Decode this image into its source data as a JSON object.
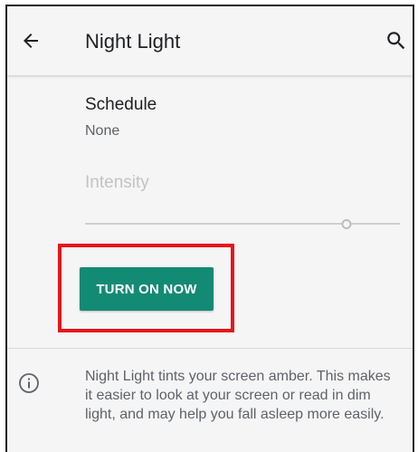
{
  "header": {
    "back_icon": "arrow-back-icon",
    "title": "Night Light",
    "search_icon": "search-icon"
  },
  "schedule": {
    "label": "Schedule",
    "value": "None"
  },
  "intensity": {
    "label": "Intensity",
    "level": 0.83,
    "enabled": false
  },
  "action": {
    "turn_on_label": "TURN ON NOW",
    "button_color": "#138a74",
    "highlight_color": "#e8141b"
  },
  "footer": {
    "info_icon": "info-icon",
    "text": "Night Light tints your screen amber. This makes it easier to look at your screen or read in dim light, and may help you fall asleep more easily."
  }
}
